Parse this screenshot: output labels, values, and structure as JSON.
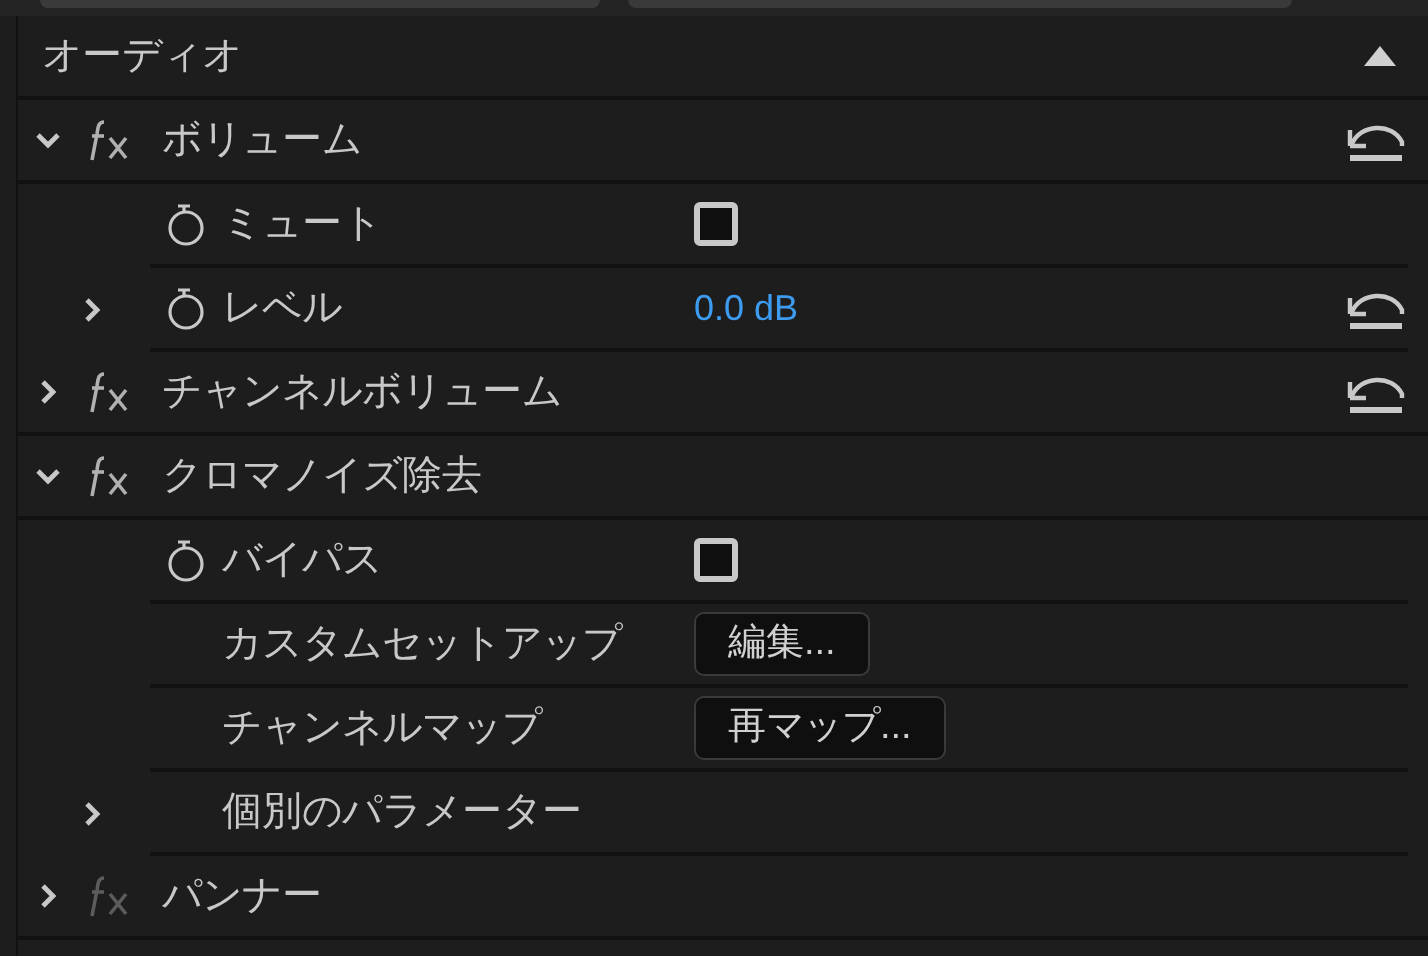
{
  "section": {
    "title": "オーディオ",
    "collapsed": false
  },
  "effects": [
    {
      "name": "ボリューム",
      "expanded": true,
      "fx_enabled": true,
      "resettable": true,
      "params": [
        {
          "kind": "checkbox",
          "name": "ミュート",
          "stopwatch": true,
          "checked": false,
          "resettable": false
        },
        {
          "kind": "value",
          "name": "レベル",
          "stopwatch": true,
          "expandable": true,
          "expanded": false,
          "value": "0.0 dB",
          "resettable": true
        }
      ]
    },
    {
      "name": "チャンネルボリューム",
      "expanded": false,
      "fx_enabled": true,
      "resettable": true
    },
    {
      "name": "クロマノイズ除去",
      "expanded": true,
      "fx_enabled": true,
      "resettable": false,
      "params": [
        {
          "kind": "checkbox",
          "name": "バイパス",
          "stopwatch": true,
          "checked": false,
          "resettable": false
        },
        {
          "kind": "button",
          "name": "カスタムセットアップ",
          "stopwatch": false,
          "button": "編集...",
          "resettable": false
        },
        {
          "kind": "button",
          "name": "チャンネルマップ",
          "stopwatch": false,
          "button": "再マップ...",
          "resettable": false
        },
        {
          "kind": "group",
          "name": "個別のパラメーター",
          "stopwatch": false,
          "expandable": true,
          "expanded": false,
          "resettable": false
        }
      ]
    },
    {
      "name": "パンナー",
      "expanded": false,
      "fx_enabled": false,
      "resettable": false
    }
  ]
}
